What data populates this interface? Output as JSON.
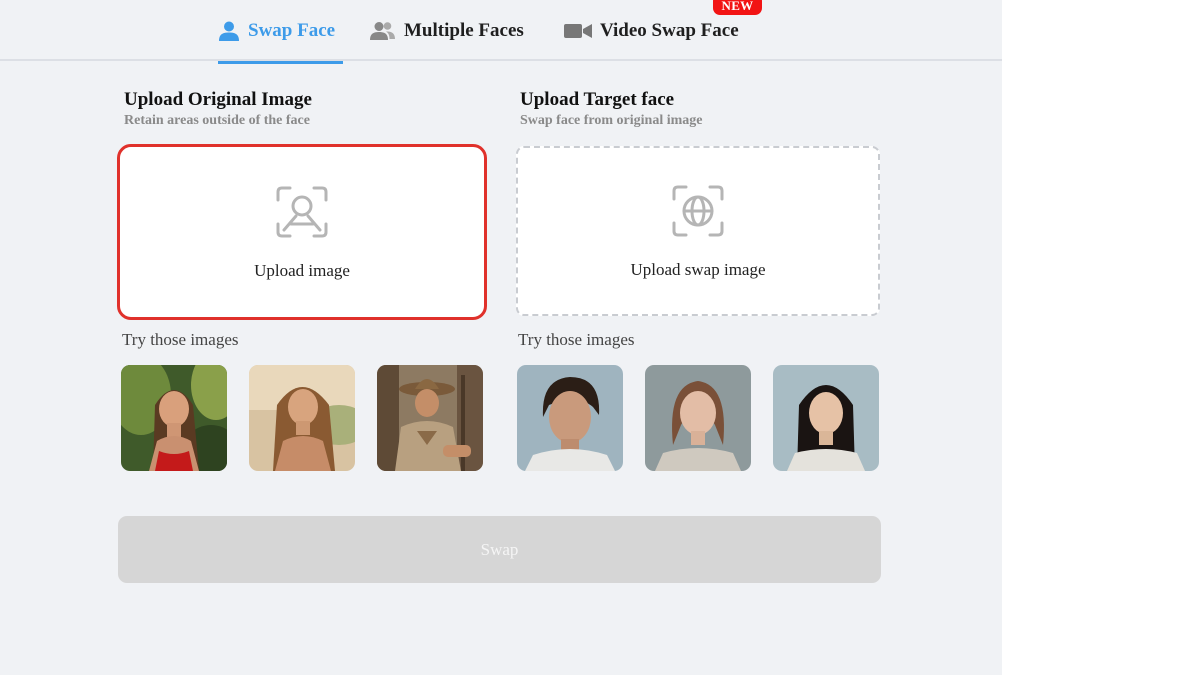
{
  "tabs": [
    {
      "label": "Swap Face",
      "icon": "person-icon",
      "active": true
    },
    {
      "label": "Multiple Faces",
      "icon": "people-icon",
      "active": false
    },
    {
      "label": "Video Swap Face",
      "icon": "video-camera-icon",
      "active": false,
      "badge": "NEW"
    }
  ],
  "left": {
    "title": "Upload Original Image",
    "subtitle": "Retain areas outside of the face",
    "upload_label": "Upload image",
    "upload_icon": "face-scan-icon",
    "try_label": "Try those images",
    "samples": [
      "sample-woman-jungle",
      "sample-woman-beach",
      "sample-cowboy"
    ]
  },
  "right": {
    "title": "Upload Target face",
    "subtitle": "Swap face from original image",
    "upload_label": "Upload swap image",
    "upload_icon": "globe-scan-icon",
    "try_label": "Try those images",
    "samples": [
      "sample-man-curly-hair",
      "sample-woman-freckles",
      "sample-woman-dark-hair"
    ]
  },
  "swap_button": {
    "label": "Swap",
    "disabled": true
  },
  "colors": {
    "accent": "#3d9be9",
    "badge": "#f21414",
    "highlight": "#e0312b",
    "disabled_button": "#d6d6d6"
  }
}
